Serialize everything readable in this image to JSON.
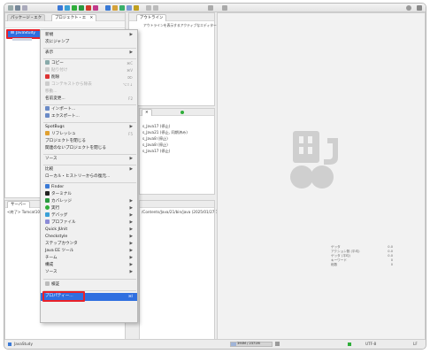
{
  "tabs": {
    "package_explorer": "パッケージ・エク",
    "project_explorer": "プロジェクト・エ",
    "outline": "アウトライン"
  },
  "outline_message": "アウトラインを表示するアクティブなエディターがありません。",
  "tree": {
    "project": "JavaStudy"
  },
  "menu": {
    "items": [
      {
        "label": "新規",
        "arrow": true
      },
      {
        "label": "次にジャンプ"
      },
      {
        "label": "表示",
        "arrow": true
      },
      {
        "label": "コピー",
        "shortcut": "⌘C"
      },
      {
        "label": "貼り付け",
        "shortcut": "⌘V",
        "disabled": true
      },
      {
        "label": "削除",
        "shortcut": "⌦"
      },
      {
        "label": "コンテキストから除去",
        "shortcut": "⌥⇧↓",
        "disabled": true
      },
      {
        "label": "移動...",
        "disabled": true
      },
      {
        "label": "名前変更...",
        "shortcut": "F2"
      },
      {
        "label": "インポート..."
      },
      {
        "label": "エクスポート..."
      },
      {
        "label": "SpotBugs",
        "arrow": true
      },
      {
        "label": "リフレッシュ",
        "shortcut": "F5"
      },
      {
        "label": "プロジェクトを閉じる"
      },
      {
        "label": "関連のないプロジェクトを閉じる"
      },
      {
        "label": "ソース",
        "arrow": true
      },
      {
        "label": "比較",
        "arrow": true
      },
      {
        "label": "ローカル・ヒストリーからの復元..."
      },
      {
        "label": "Finder"
      },
      {
        "label": "ターミナル"
      },
      {
        "label": "カバレッジ",
        "arrow": true
      },
      {
        "label": "実行",
        "arrow": true
      },
      {
        "label": "デバッグ",
        "arrow": true
      },
      {
        "label": "プロファイル",
        "arrow": true
      },
      {
        "label": "Quick JUnit",
        "arrow": true
      },
      {
        "label": "Checkstyle",
        "arrow": true
      },
      {
        "label": "ステップカウンタ",
        "arrow": true
      },
      {
        "label": "Java EE ツール",
        "arrow": true
      },
      {
        "label": "チーム",
        "arrow": true
      },
      {
        "label": "構成",
        "arrow": true
      },
      {
        "label": "ソース",
        "arrow": true
      },
      {
        "label": "検証"
      },
      {
        "label": "プロパティー...",
        "shortcut": "⌘I"
      }
    ]
  },
  "console_lines": [
    "s_Java17 (停止)",
    "s_Java21 (停止, 同期済み)",
    "s_Java8 (停止)",
    "s_Java8 (停止)",
    "s_Java17 (停止)"
  ],
  "bottom_left": {
    "header": "サーバー",
    "line": "<終了> Tomcat10_Ja"
  },
  "bottom_center": {
    "line": "/Contents/Java/21/bin/java (2025/01/27 18"
  },
  "memory_info": [
    {
      "label": "ゲッタ",
      "value": "0.0"
    },
    {
      "label": "アクション数 (平均)",
      "value": "0.0"
    },
    {
      "label": "ゲッタ (平均)",
      "value": "0.0"
    },
    {
      "label": "キーワード",
      "value": "0"
    },
    {
      "label": "総数",
      "value": "0"
    }
  ],
  "status": {
    "left": "JavaStudy",
    "heap": "390M / 2371M",
    "encoding": "UTF-8",
    "line_ending": "LF"
  },
  "colors": {
    "accent": "#2f6fe0",
    "highlight_box": "#e8212a",
    "logo": "#cfcfcf"
  }
}
